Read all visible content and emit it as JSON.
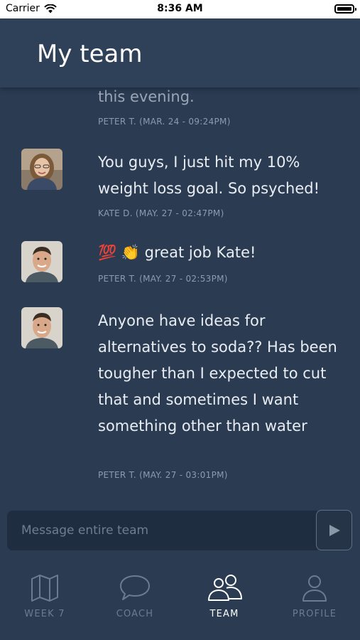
{
  "status_bar": {
    "carrier": "Carrier",
    "time": "8:36 AM"
  },
  "header": {
    "title": "My team"
  },
  "messages": [
    {
      "author": "Peter T.",
      "text": "this evening.",
      "meta": "PETER T. (MAR. 24 - 09:24PM)",
      "avatar": "peter-avatar"
    },
    {
      "author": "Kate D.",
      "text": "You guys, I just hit my 10% weight loss goal. So psyched!",
      "meta": "KATE D. (MAY. 27 - 02:47PM)",
      "avatar": "kate-avatar"
    },
    {
      "author": "Peter T.",
      "emoji": "💯 👏",
      "text": "great job Kate!",
      "meta": "PETER T. (MAY. 27 - 02:53PM)",
      "avatar": "peter-avatar"
    },
    {
      "author": "Peter T.",
      "text": "Anyone have ideas for alternatives to soda?? Has been tougher than I expected to cut that and sometimes I want something other than water",
      "meta": "PETER T. (MAY. 27 - 03:01PM)",
      "avatar": "peter-avatar"
    }
  ],
  "composer": {
    "placeholder": "Message entire team",
    "send_icon": "play-triangle-icon"
  },
  "tabs": [
    {
      "label": "WEEK 7",
      "icon": "map-icon",
      "active": false
    },
    {
      "label": "COACH",
      "icon": "speech-bubble-icon",
      "active": false
    },
    {
      "label": "TEAM",
      "icon": "team-icon",
      "active": true
    },
    {
      "label": "PROFILE",
      "icon": "person-icon",
      "active": false
    }
  ],
  "colors": {
    "background": "#2a3b52",
    "header": "#2e4159",
    "text": "#e9edf3",
    "meta": "#8d9bb0",
    "inactive_tab": "#6c7b90",
    "active_tab": "#ffffff"
  }
}
